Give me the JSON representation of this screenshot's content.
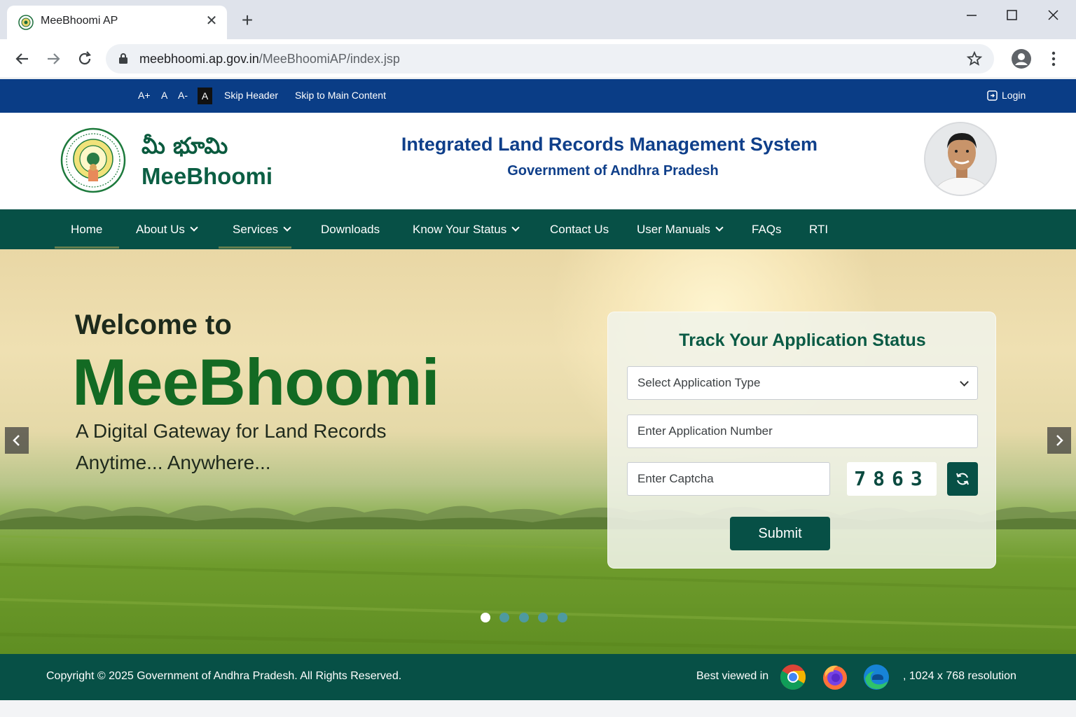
{
  "browser": {
    "tab_title": "MeeBhoomi AP",
    "url_host": "meebhoomi.ap.gov.in",
    "url_path": "/MeeBhoomiAP/index.jsp"
  },
  "utility_bar": {
    "font_larger": "A+",
    "font_normal": "A",
    "font_smaller": "A-",
    "high_contrast": "A",
    "skip_header": "Skip Header",
    "skip_main": "Skip to Main Content",
    "login": "Login"
  },
  "header": {
    "brand_telugu": "మీ భూమి",
    "brand_english": "MeeBhoomi",
    "system_title": "Integrated Land Records Management System",
    "system_subtitle": "Government of Andhra Pradesh"
  },
  "nav": {
    "items": [
      {
        "label": "Home",
        "has_dropdown": false
      },
      {
        "label": "About Us",
        "has_dropdown": true
      },
      {
        "label": "Services",
        "has_dropdown": true
      },
      {
        "label": "Downloads",
        "has_dropdown": false
      },
      {
        "label": "Know Your Status",
        "has_dropdown": true
      },
      {
        "label": "Contact Us",
        "has_dropdown": false
      },
      {
        "label": "User Manuals",
        "has_dropdown": true
      },
      {
        "label": "FAQs",
        "has_dropdown": false
      },
      {
        "label": "RTI",
        "has_dropdown": false
      }
    ]
  },
  "hero": {
    "welcome": "Welcome to",
    "title": "MeeBhoomi",
    "tagline_line1": "A Digital Gateway for Land Records",
    "tagline_line2": "Anytime... Anywhere...",
    "slide_count": 5,
    "active_slide": 1
  },
  "track_form": {
    "title": "Track Your Application Status",
    "application_type_selected": "Select Application Type",
    "application_number_placeholder": "Enter Application Number",
    "captcha_placeholder": "Enter Captcha",
    "captcha_code": "7863",
    "submit_label": "Submit"
  },
  "footer": {
    "copyright": "Copyright © 2025 Government of Andhra Pradesh. All Rights Reserved.",
    "best_viewed": "Best viewed in",
    "browsers": [
      "chrome-icon",
      "firefox-icon",
      "edge-icon"
    ],
    "resolution": ", 1024 x 768 resolution"
  },
  "colors": {
    "utility_bar_blue": "#0a3d86",
    "nav_green": "#075046",
    "brand_green": "#0b5e43",
    "title_blue": "#0f3f8a",
    "hero_title_green": "#136a23"
  }
}
